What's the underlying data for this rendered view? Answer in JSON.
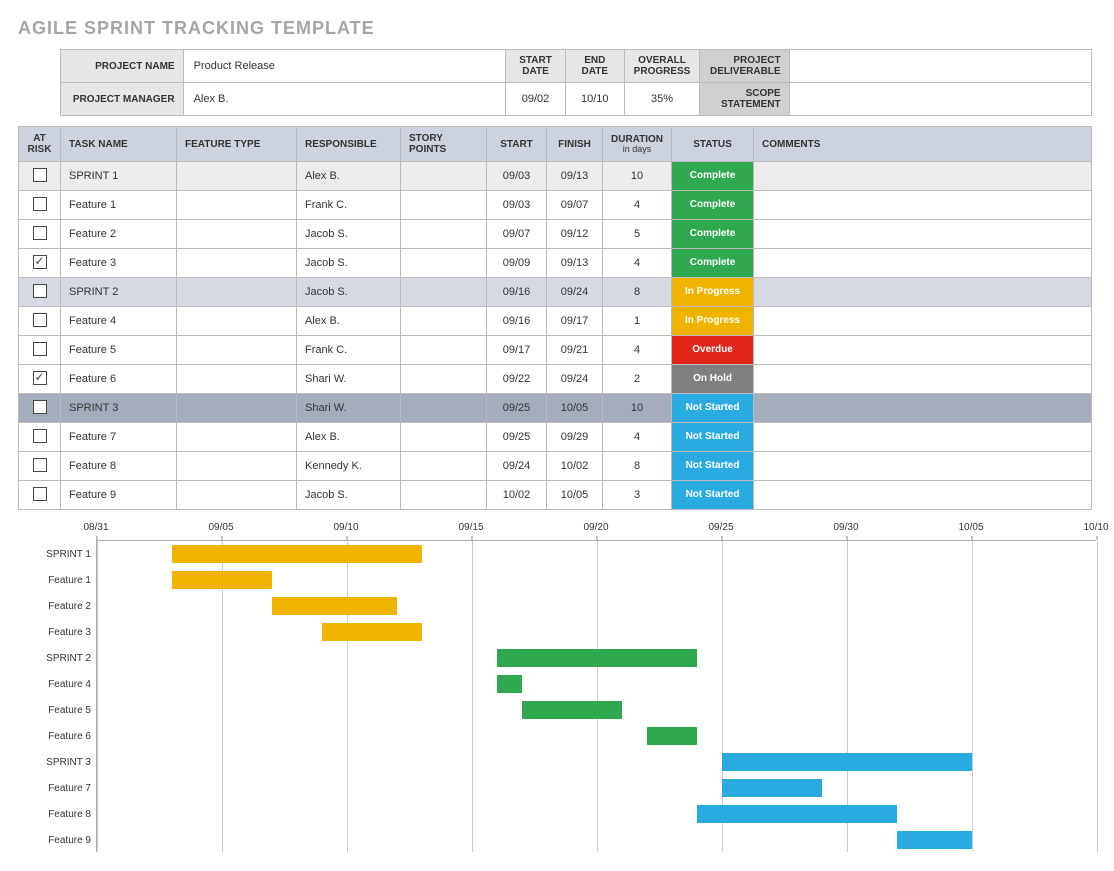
{
  "title": "AGILE SPRINT TRACKING TEMPLATE",
  "header": {
    "labels": {
      "project_name": "PROJECT NAME",
      "project_manager": "PROJECT MANAGER",
      "start_date": "START DATE",
      "end_date": "END DATE",
      "overall_progress": "OVERALL PROGRESS",
      "project_deliverable": "PROJECT DELIVERABLE",
      "scope_statement": "SCOPE STATEMENT"
    },
    "values": {
      "project_name": "Product Release",
      "project_manager": "Alex B.",
      "start_date": "09/02",
      "end_date": "10/10",
      "overall_progress": "35%",
      "project_deliverable": "",
      "scope_statement": ""
    }
  },
  "columns": {
    "at_risk": "AT RISK",
    "task_name": "TASK NAME",
    "feature_type": "FEATURE TYPE",
    "responsible": "RESPONSIBLE",
    "story_points": "STORY POINTS",
    "start": "START",
    "finish": "FINISH",
    "duration": "DURATION",
    "duration_sub": "in days",
    "status": "STATUS",
    "comments": "COMMENTS"
  },
  "status_labels": {
    "complete": "Complete",
    "in_progress": "In Progress",
    "overdue": "Overdue",
    "on_hold": "On Hold",
    "not_started": "Not Started"
  },
  "rows": [
    {
      "at_risk": false,
      "task": "SPRINT 1",
      "responsible": "Alex B.",
      "start": "09/03",
      "finish": "09/13",
      "duration": "10",
      "status": "complete",
      "group": "sprint1"
    },
    {
      "at_risk": false,
      "task": "Feature 1",
      "responsible": "Frank C.",
      "start": "09/03",
      "finish": "09/07",
      "duration": "4",
      "status": "complete",
      "group": ""
    },
    {
      "at_risk": false,
      "task": "Feature 2",
      "responsible": "Jacob S.",
      "start": "09/07",
      "finish": "09/12",
      "duration": "5",
      "status": "complete",
      "group": ""
    },
    {
      "at_risk": true,
      "task": "Feature 3",
      "responsible": "Jacob S.",
      "start": "09/09",
      "finish": "09/13",
      "duration": "4",
      "status": "complete",
      "group": ""
    },
    {
      "at_risk": false,
      "task": "SPRINT 2",
      "responsible": "Jacob S.",
      "start": "09/16",
      "finish": "09/24",
      "duration": "8",
      "status": "in_progress",
      "group": "sprint2"
    },
    {
      "at_risk": false,
      "task": "Feature 4",
      "responsible": "Alex B.",
      "start": "09/16",
      "finish": "09/17",
      "duration": "1",
      "status": "in_progress",
      "group": ""
    },
    {
      "at_risk": false,
      "task": "Feature 5",
      "responsible": "Frank C.",
      "start": "09/17",
      "finish": "09/21",
      "duration": "4",
      "status": "overdue",
      "group": ""
    },
    {
      "at_risk": true,
      "task": "Feature 6",
      "responsible": "Shari W.",
      "start": "09/22",
      "finish": "09/24",
      "duration": "2",
      "status": "on_hold",
      "group": ""
    },
    {
      "at_risk": false,
      "task": "SPRINT 3",
      "responsible": "Shari W.",
      "start": "09/25",
      "finish": "10/05",
      "duration": "10",
      "status": "not_started",
      "group": "sprint3"
    },
    {
      "at_risk": false,
      "task": "Feature 7",
      "responsible": "Alex B.",
      "start": "09/25",
      "finish": "09/29",
      "duration": "4",
      "status": "not_started",
      "group": ""
    },
    {
      "at_risk": false,
      "task": "Feature 8",
      "responsible": "Kennedy K.",
      "start": "09/24",
      "finish": "10/02",
      "duration": "8",
      "status": "not_started",
      "group": ""
    },
    {
      "at_risk": false,
      "task": "Feature 9",
      "responsible": "Jacob S.",
      "start": "10/02",
      "finish": "10/05",
      "duration": "3",
      "status": "not_started",
      "group": ""
    }
  ],
  "chart_data": {
    "type": "bar",
    "orientation": "horizontal_gantt",
    "x_axis": "date",
    "x_range": [
      "08/31",
      "10/10"
    ],
    "x_ticks": [
      "08/31",
      "09/05",
      "09/10",
      "09/15",
      "09/20",
      "09/25",
      "09/30",
      "10/05",
      "10/10"
    ],
    "colors": {
      "yellow": "#f0b400",
      "green": "#2fa84f",
      "blue": "#29abe2"
    },
    "series": [
      {
        "name": "SPRINT 1",
        "start": "09/03",
        "end": "09/13",
        "color": "yellow"
      },
      {
        "name": "Feature 1",
        "start": "09/03",
        "end": "09/07",
        "color": "yellow"
      },
      {
        "name": "Feature 2",
        "start": "09/07",
        "end": "09/12",
        "color": "yellow"
      },
      {
        "name": "Feature 3",
        "start": "09/09",
        "end": "09/13",
        "color": "yellow"
      },
      {
        "name": "SPRINT 2",
        "start": "09/16",
        "end": "09/24",
        "color": "green"
      },
      {
        "name": "Feature 4",
        "start": "09/16",
        "end": "09/17",
        "color": "green"
      },
      {
        "name": "Feature 5",
        "start": "09/17",
        "end": "09/21",
        "color": "green"
      },
      {
        "name": "Feature 6",
        "start": "09/22",
        "end": "09/24",
        "color": "green"
      },
      {
        "name": "SPRINT 3",
        "start": "09/25",
        "end": "10/05",
        "color": "blue"
      },
      {
        "name": "Feature 7",
        "start": "09/25",
        "end": "09/29",
        "color": "blue"
      },
      {
        "name": "Feature 8",
        "start": "09/24",
        "end": "10/02",
        "color": "blue"
      },
      {
        "name": "Feature 9",
        "start": "10/02",
        "end": "10/05",
        "color": "blue"
      }
    ]
  }
}
